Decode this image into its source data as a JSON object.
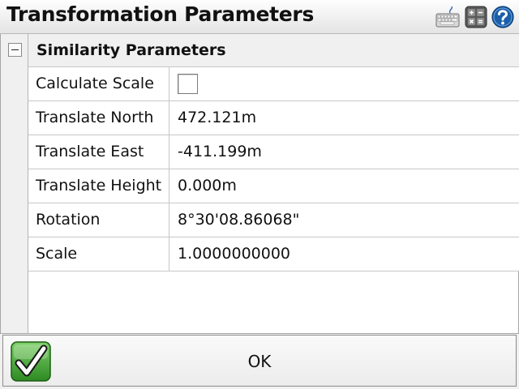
{
  "window": {
    "title": "Transformation Parameters"
  },
  "toolbar_icons": [
    "keyboard-icon",
    "calculator-icon",
    "help-icon"
  ],
  "section": {
    "title": "Similarity Parameters",
    "expanded": true
  },
  "rows": [
    {
      "label": "Calculate Scale",
      "type": "checkbox",
      "checked": false
    },
    {
      "label": "Translate North",
      "value": "472.121m"
    },
    {
      "label": "Translate East",
      "value": "-411.199m"
    },
    {
      "label": "Translate Height",
      "value": "0.000m"
    },
    {
      "label": "Rotation",
      "value": "8°30'08.86068\""
    },
    {
      "label": "Scale",
      "value": "1.0000000000"
    }
  ],
  "footer": {
    "ok_label": "OK"
  },
  "colors": {
    "accent_green": "#3a9b2a",
    "help_blue": "#1b5fa8"
  }
}
